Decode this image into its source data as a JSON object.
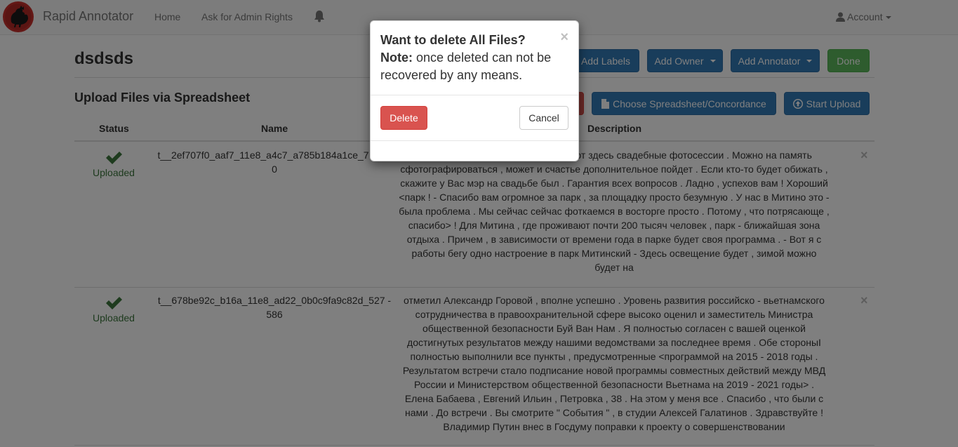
{
  "navbar": {
    "brand": "Rapid Annotator",
    "links": [
      "Home",
      "Ask for Admin Rights"
    ],
    "account": "Account",
    "icons": {
      "logo": "rooster-logo",
      "bell": "bell-icon",
      "user": "user-icon"
    }
  },
  "page": {
    "title": "dsdsds",
    "buttons": {
      "add_labels": "Add Labels",
      "add_owner": "Add Owner",
      "add_annotator": "Add Annotator",
      "done": "Done",
      "choose_spreadsheet": "Choose Spreadsheet/Concordance",
      "start_upload": "Start Upload"
    },
    "section_title": "Upload Files via Spreadsheet"
  },
  "table": {
    "headers": {
      "status": "Status",
      "name": "Name",
      "description": "Description"
    },
    "rows": [
      {
        "status": "Uploaded",
        "name": "t__2ef707f0_aaf7_11e8_a4c7_a785b184a1ce_7 -7460",
        "description": "полюбили молодожены . Устраивают здесь свадебные фотосессии . Можно на память сфотографироваться , может и счастье дополнительное пойдет . Если кто-то будет обижать , скажите у Вас мэр на свадьбе был . Гарантия всех вопросов . Ладно , успехов вам ! Хороший <парк ! - Спасибо вам огромное за парк , за площадку просто безумную . У нас в Митино это - была проблема . Мы сейчас сейчас фоткаемся в восторге просто . Потому , что потрясающе , спасибо> ! Для Митина , где проживают почти 200 тысяч человек , парк - ближайшая зона отдыха . Причем , в зависимости от времени года в парке будет своя программа . - Вот я с работы бегу одно настроение в парк Митинский - Здесь освещение будет , зимой можно будет на"
      },
      {
        "status": "Uploaded",
        "name": "t__678be92c_b16a_11e8_ad22_0b0c9fa9c82d_527 -586",
        "description": "отметил Александр Горовой , вполне успешно . Уровень развития российско - вьетнамского сотрудничества в правоохранительной сфере высоко оценил и заместитель Министра общественной безопасности Буй Ван Нам . Я полностью согласен с вашей оценкой достигнутых результатов между нашими ведомствами за последнее время . Обе стороныI полностью выполнили все пункты , предусмотренные <программой на 2015 - 2018 годы . Результатом встречи стало подписание новой программы совместных действий между МВД России и Министерством общественной безопасности Вьетнама на 2019 - 2021 годы> . Елена Бабаева , Евгений Ильин , Петровка , 38 . На этом у меня все . Спасибо , что были с нами . До встречи . Вы смотрите \" События \" , в студии Алексей Галатинов . Здравствуйте ! Владимир Путин внес в Госдуму поправки к проекту о совершенствовании"
      }
    ],
    "row_close": "×"
  },
  "modal": {
    "title": "Want to delete All Files?",
    "note_label": "Note:",
    "note_text": "once deleted can not be recovered by any means.",
    "close": "×",
    "delete_label": "Delete",
    "cancel_label": "Cancel"
  },
  "colors": {
    "primary": "#337ab7",
    "success": "#5cb85c",
    "danger": "#d9534f",
    "status_text": "#3c763d"
  }
}
